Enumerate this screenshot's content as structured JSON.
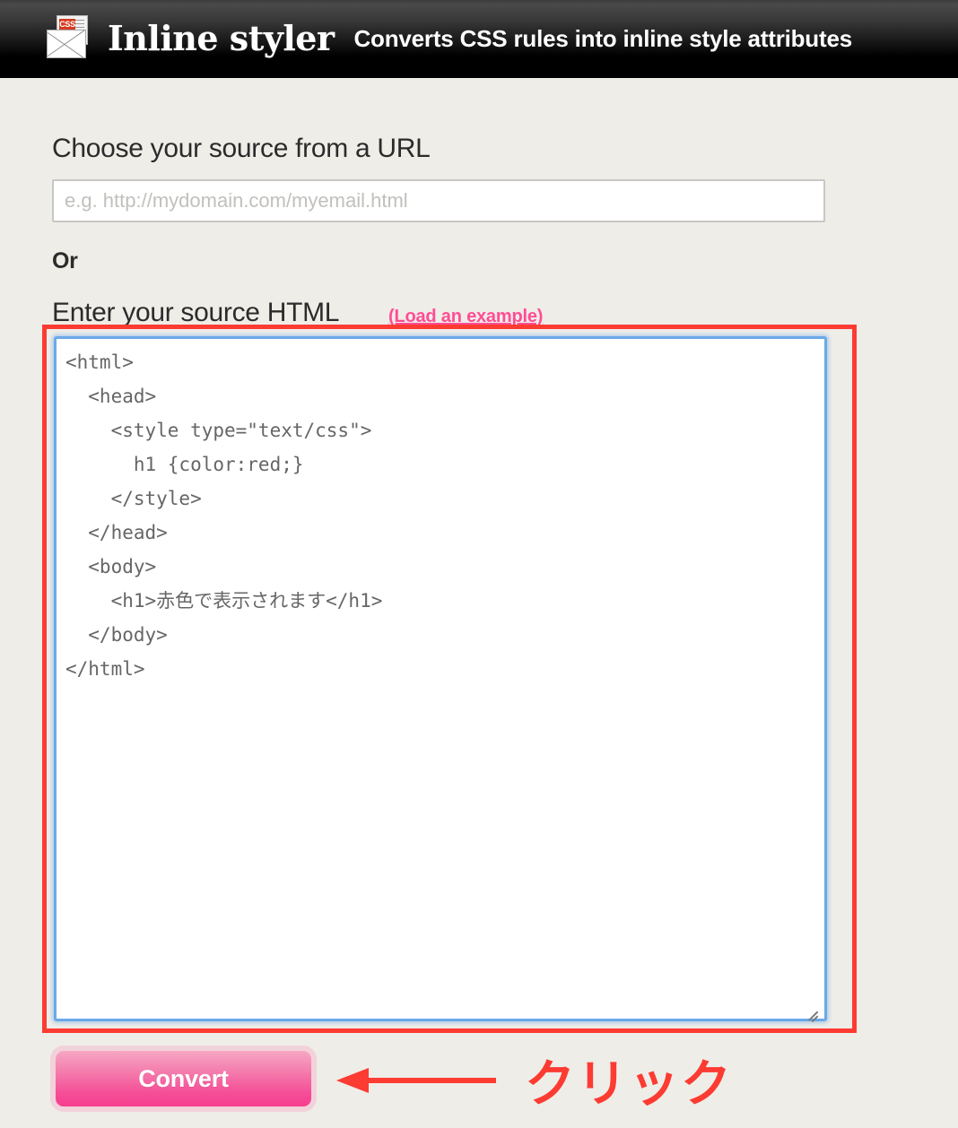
{
  "header": {
    "logo_icon": "css-envelope-icon",
    "logo_badge": "CSS",
    "title": "Inline styler",
    "tagline": "Converts CSS rules into inline style attributes"
  },
  "form": {
    "url_label": "Choose your source from a URL",
    "url_placeholder": "e.g. http://mydomain.com/myemail.html",
    "url_value": "",
    "or_label": "Or",
    "html_label": "Enter your source HTML",
    "example_link": "(Load an example)",
    "source_html": "<html>\n  <head>\n    <style type=\"text/css\">\n      h1 {color:red;}\n    </style>\n  </head>\n  <body>\n    <h1>赤色で表示されます</h1>\n  </body>\n</html>",
    "convert_label": "Convert"
  },
  "annotations": {
    "click_label": "クリック",
    "arrow_icon": "left-arrow-icon",
    "highlight_color": "#fc3b32"
  },
  "colors": {
    "page_background": "#efede8",
    "header_background": "#000000",
    "accent_pink": "#ff4d94",
    "button_pink": "#f54f97",
    "annotation_red": "#fc3b32",
    "focus_blue": "#6aa9e9"
  }
}
